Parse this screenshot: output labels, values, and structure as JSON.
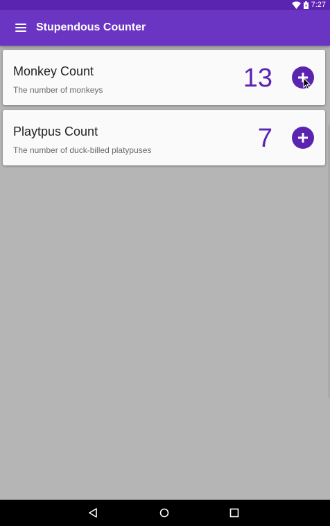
{
  "status_bar": {
    "time": "7:27",
    "icons": [
      "wifi-icon",
      "battery-charging-icon"
    ]
  },
  "app_bar": {
    "title": "Stupendous Counter",
    "menu_icon": "menu-icon"
  },
  "counters": [
    {
      "title": "Monkey Count",
      "subtitle": "The number of monkeys",
      "count": "13",
      "button_icon": "plus-icon"
    },
    {
      "title": "Playtpus Count",
      "subtitle": "The number of duck-billed platypuses",
      "count": "7",
      "button_icon": "plus-icon"
    }
  ],
  "nav_bar": {
    "icons": [
      "back-icon",
      "home-icon",
      "recents-icon"
    ]
  },
  "colors": {
    "primary": "#6a35c2",
    "primary_dark": "#5b24b0",
    "background": "#b5b5b5",
    "card": "#fafafa"
  }
}
